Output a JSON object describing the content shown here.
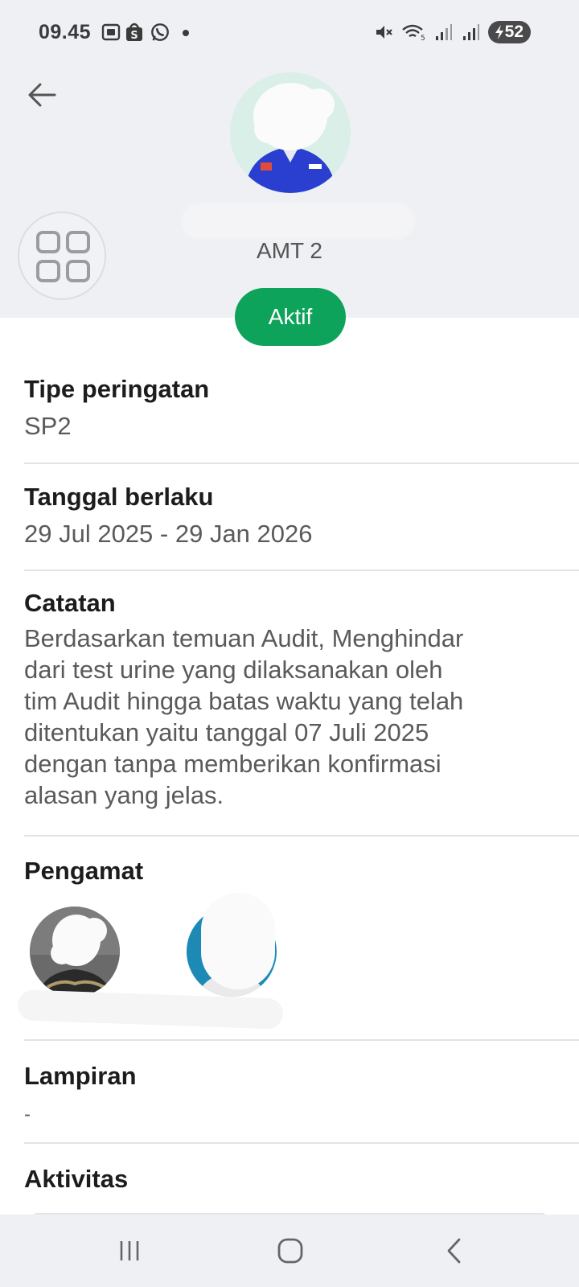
{
  "status_bar": {
    "time": "09.45",
    "battery": "52"
  },
  "header": {
    "role": "AMT 2",
    "status_badge": "Aktif"
  },
  "sections": {
    "type": {
      "title": "Tipe peringatan",
      "value": "SP2"
    },
    "date": {
      "title": "Tanggal berlaku",
      "value": "29 Jul 2025 - 29 Jan 2026"
    },
    "notes": {
      "title": "Catatan",
      "lines": [
        "Berdasarkan temuan Audit, Menghindar",
        "dari test urine yang dilaksanakan oleh",
        "tim Audit hingga batas waktu yang telah",
        "ditentukan yaitu tanggal 07 Juli 2025",
        "dengan tanpa memberikan konfirmasi",
        "alasan yang jelas."
      ]
    },
    "observers": {
      "title": "Pengamat"
    },
    "attachments": {
      "title": "Lampiran",
      "value": "-"
    },
    "activity": {
      "title": "Aktivitas"
    }
  },
  "colors": {
    "accent_green": "#0ea35a",
    "header_bg": "#eef0f4"
  },
  "icons": [
    "back-arrow-icon",
    "grid-icon",
    "menu-icon",
    "home-icon",
    "nav-back-icon"
  ]
}
